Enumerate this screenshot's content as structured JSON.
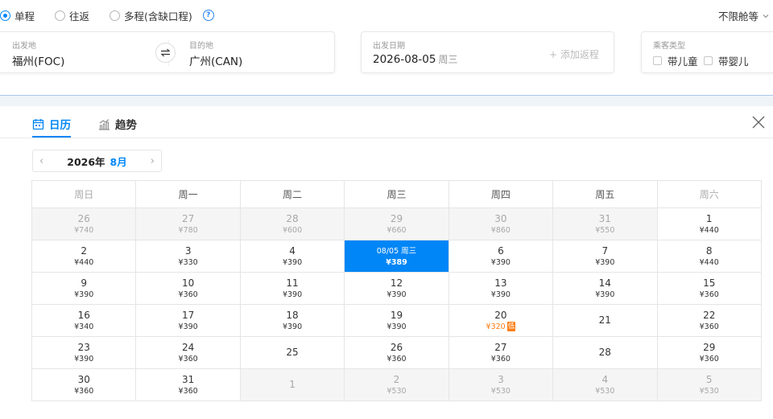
{
  "trip_types": [
    {
      "label": "单程",
      "checked": true
    },
    {
      "label": "往返",
      "checked": false
    },
    {
      "label": "多程(含缺口程)",
      "checked": false
    }
  ],
  "help_icon": "?",
  "cabin_class": "不限舱等",
  "search": {
    "depart_city": {
      "label": "出发地",
      "value": "福州(FOC)"
    },
    "arrive_city": {
      "label": "目的地",
      "value": "广州(CAN)"
    },
    "depart_date": {
      "label": "出发日期",
      "value": "2026-08-05",
      "weekday": "周三"
    },
    "add_return": "+ 添加返程",
    "passenger_type": {
      "label": "乘客类型",
      "options": [
        "带儿童",
        "带婴儿"
      ]
    }
  },
  "tabs": {
    "calendar": "日历",
    "trend": "趋势"
  },
  "month_nav": {
    "year": "2026年",
    "month": "8月",
    "prev": "‹",
    "next": "›"
  },
  "weekday_headers": [
    "周日",
    "周一",
    "周二",
    "周三",
    "周四",
    "周五",
    "周六"
  ],
  "colors": {
    "accent": "#0086f6",
    "low_price": "#ff7d13"
  },
  "calendar": [
    [
      {
        "d": "26",
        "p": "¥740",
        "out": true
      },
      {
        "d": "27",
        "p": "¥780",
        "out": true
      },
      {
        "d": "28",
        "p": "¥600",
        "out": true
      },
      {
        "d": "29",
        "p": "¥660",
        "out": true
      },
      {
        "d": "30",
        "p": "¥860",
        "out": true
      },
      {
        "d": "31",
        "p": "¥550",
        "out": true
      },
      {
        "d": "1",
        "p": "¥440"
      }
    ],
    [
      {
        "d": "2",
        "p": "¥440"
      },
      {
        "d": "3",
        "p": "¥330"
      },
      {
        "d": "4",
        "p": "¥390"
      },
      {
        "d": "08/05 周三",
        "p": "¥389",
        "selected": true
      },
      {
        "d": "6",
        "p": "¥390"
      },
      {
        "d": "7",
        "p": "¥390"
      },
      {
        "d": "8",
        "p": "¥440"
      }
    ],
    [
      {
        "d": "9",
        "p": "¥390"
      },
      {
        "d": "10",
        "p": "¥360"
      },
      {
        "d": "11",
        "p": "¥390"
      },
      {
        "d": "12",
        "p": "¥390"
      },
      {
        "d": "13",
        "p": "¥390"
      },
      {
        "d": "14",
        "p": "¥390"
      },
      {
        "d": "15",
        "p": "¥360"
      }
    ],
    [
      {
        "d": "16",
        "p": "¥340"
      },
      {
        "d": "17",
        "p": "¥390"
      },
      {
        "d": "18",
        "p": "¥390"
      },
      {
        "d": "19",
        "p": "¥390"
      },
      {
        "d": "20",
        "p": "¥320",
        "low": true,
        "tag": "低"
      },
      {
        "d": "21",
        "p": ""
      },
      {
        "d": "22",
        "p": "¥360"
      }
    ],
    [
      {
        "d": "23",
        "p": "¥390"
      },
      {
        "d": "24",
        "p": "¥360"
      },
      {
        "d": "25",
        "p": ""
      },
      {
        "d": "26",
        "p": "¥360"
      },
      {
        "d": "27",
        "p": "¥360"
      },
      {
        "d": "28",
        "p": ""
      },
      {
        "d": "29",
        "p": "¥360"
      }
    ],
    [
      {
        "d": "30",
        "p": "¥360"
      },
      {
        "d": "31",
        "p": "¥360"
      },
      {
        "d": "1",
        "p": "",
        "out": true
      },
      {
        "d": "2",
        "p": "¥530",
        "out": true
      },
      {
        "d": "3",
        "p": "¥530",
        "out": true
      },
      {
        "d": "4",
        "p": "¥530",
        "out": true
      },
      {
        "d": "5",
        "p": "¥530",
        "out": true
      }
    ]
  ]
}
